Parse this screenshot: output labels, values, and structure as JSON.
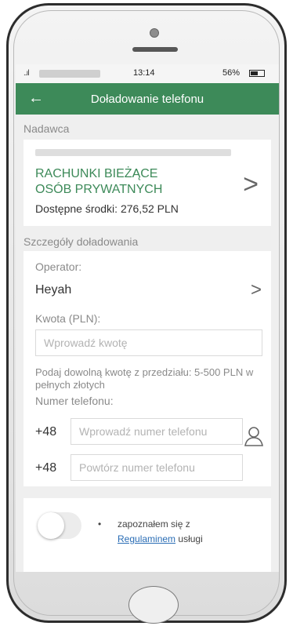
{
  "status_bar": {
    "time": "13:14",
    "battery": "56%",
    "signal": "..ıl"
  },
  "header": {
    "back_icon": "arrow-left-icon",
    "title": "Doładowanie telefonu"
  },
  "sender": {
    "section_label": "Nadawca",
    "account_name": "RACHUNKI BIEŻĄCE OSÓB PRYWATNYCH",
    "available_funds": "Dostępne środki: 276,52 PLN"
  },
  "details": {
    "section_label": "Szczegóły doładowania",
    "operator_label": "Operator:",
    "operator_value": "Heyah",
    "amount_label": "Kwota (PLN):",
    "amount_placeholder": "Wprowadź kwotę",
    "amount_hint": "Podaj dowolną kwotę z przedziału: 5-500 PLN w pełnych złotych",
    "phone_label": "Numer telefonu:",
    "phone_prefix": "+48",
    "phone_placeholder": "Wprowadź numer telefonu",
    "phone_repeat_prefix": "+48",
    "phone_repeat_placeholder": "Powtórz numer telefonu"
  },
  "consent": {
    "bullet": "•",
    "text_before": "zapoznałem się z",
    "link_text": "Regulaminem",
    "text_after": "usługi",
    "toggle_on": false
  },
  "colors": {
    "brand_green": "#3d8a59",
    "link_blue": "#2a6db5"
  }
}
